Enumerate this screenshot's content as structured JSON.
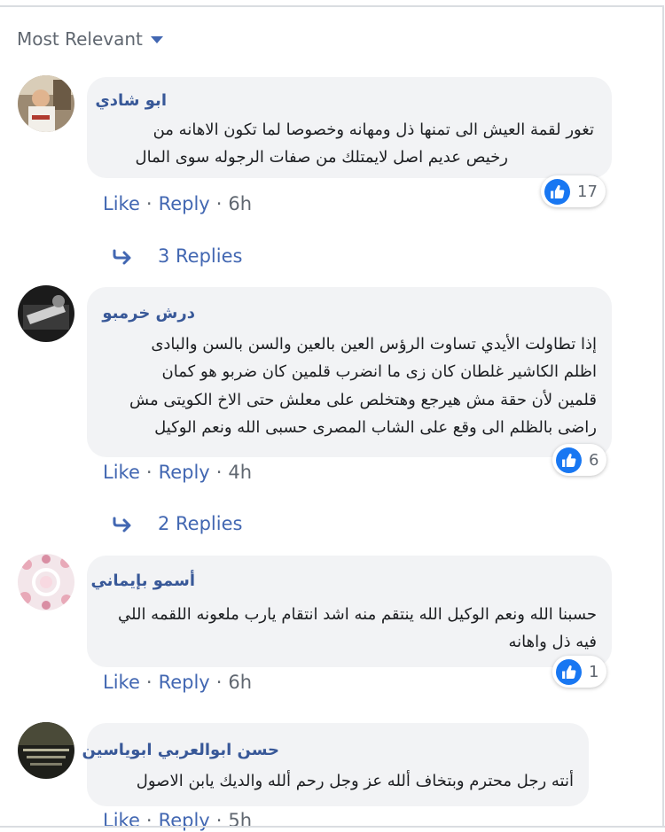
{
  "sort": {
    "label": "Most Relevant"
  },
  "colors": {
    "link": "#4267b2",
    "author": "#385898",
    "bubble": "#f2f3f5",
    "like": "#1877f2"
  },
  "comments": [
    {
      "author": "ابو شادي",
      "lines": [
        "تغور لقمة العيش الى تمنها ذل ومهانه وخصوصا لما تكون الاهانه من",
        "رخيص عديم اصل لايمتلك من صفات الرجوله سوى المال"
      ],
      "reactions": "17",
      "like": "Like",
      "reply": "Reply",
      "sep": "·",
      "time": "6h",
      "replies": "3 Replies"
    },
    {
      "author": "درش خرمبو",
      "lines": [
        "إذا تطاولت الأيدي تساوت الرؤس العين بالعين والسن بالسن والبادى",
        "اظلم الكاشير غلطان كان زى ما انضرب قلمين كان ضربو هو كمان",
        "قلمين لأن حقة مش هيرجع وهتخلص على معلش حتى الاخ الكويتى مش",
        "راضى بالظلم الى وقع على الشاب المصرى حسبى الله ونعم الوكيل"
      ],
      "reactions": "6",
      "like": "Like",
      "reply": "Reply",
      "sep": "·",
      "time": "4h",
      "replies": "2 Replies"
    },
    {
      "author": "أسمو بإيماني",
      "lines": [
        "حسبنا الله ونعم الوكيل الله ينتقم منه اشد انتقام يارب ملعونه اللقمه اللي",
        "فيه ذل واهانه"
      ],
      "reactions": "1",
      "like": "Like",
      "reply": "Reply",
      "sep": "·",
      "time": "6h"
    },
    {
      "author": "حسن ابوالعربي ابوياسين",
      "lines": [
        "أنته رجل محترم وبتخاف ألله عز وجل رحم ألله والديك يابن الاصول"
      ],
      "like": "Like",
      "reply": "Reply",
      "sep": "·",
      "time": "5h"
    }
  ]
}
